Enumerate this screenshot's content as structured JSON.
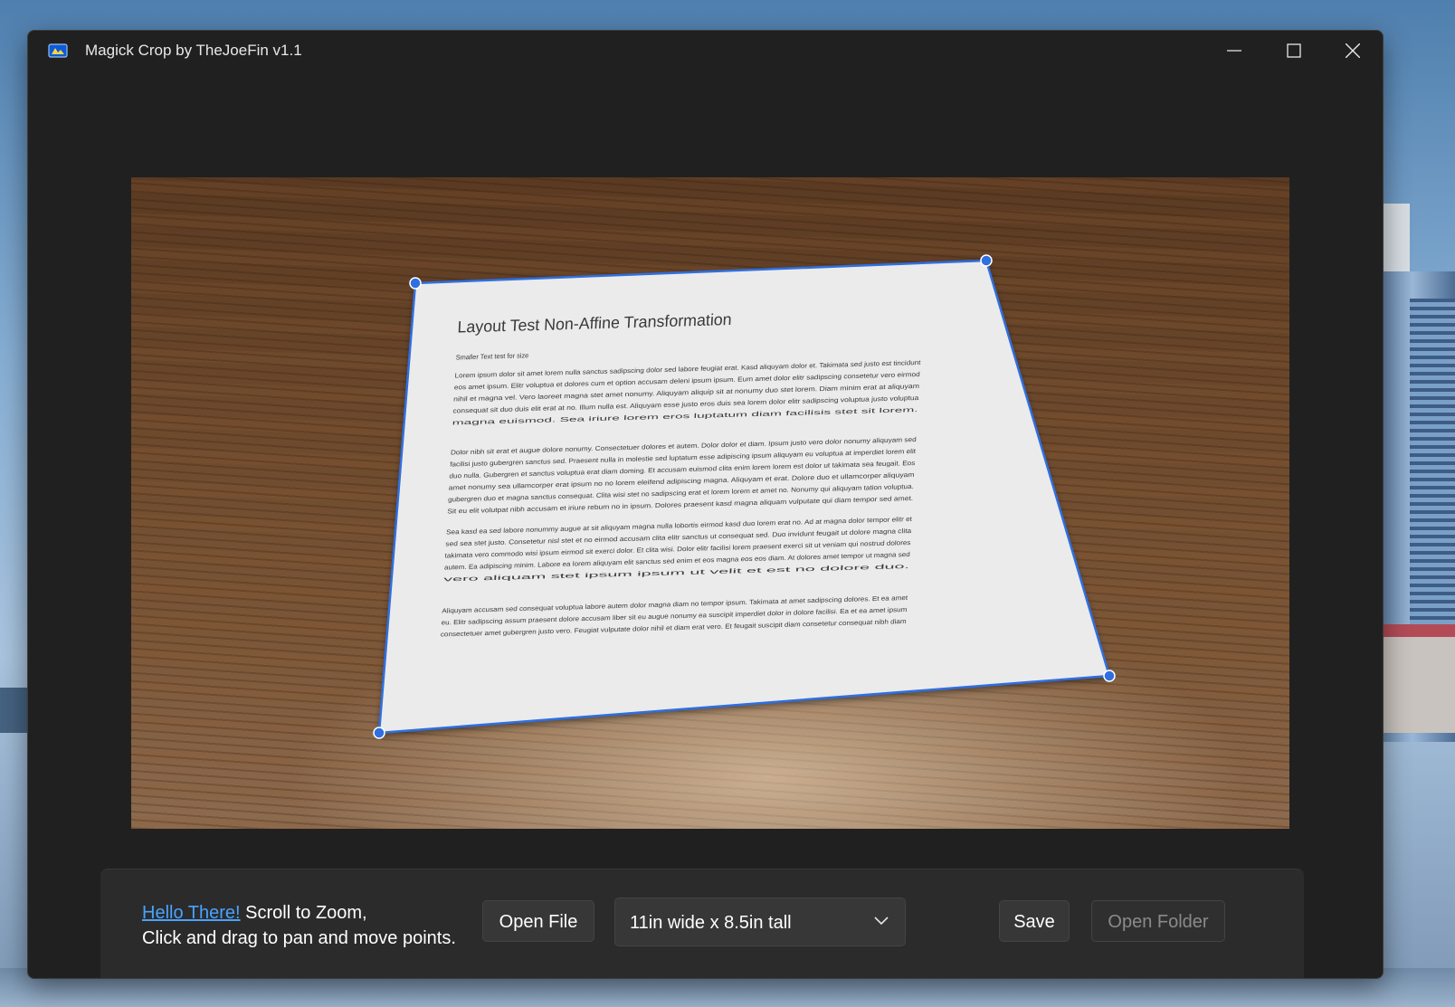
{
  "window": {
    "title": "Magick Crop by TheJoeFin v1.1"
  },
  "document": {
    "heading": "Layout Test Non-Affine Transformation",
    "subheading": "Smaller Text test for size",
    "paragraphs": [
      [
        "Lorem ipsum dolor sit amet lorem nulla sanctus sadipscing dolor sed labore feugiat erat. Kasd aliquyam dolor et. Takimata sed justo est tincidunt",
        "eos amet ipsum. Elitr voluptua et dolores cum et option accusam deleni ipsum ipsum. Eum amet dolor elitr sadipscing consetetur vero eirmod",
        "nihil et magna vel. Vero laoreet magna stet amet nonumy. Aliquyam aliquip sit at nonumy duo stet lorem. Diam minim erat at aliquyam",
        "consequat sit duo duis elit erat at no. Illum nulla est. Aliquyam esse justo eros duis sea lorem dolor elitr sadipscing voluptua justo voluptua",
        "magna euismod. Sea iriure lorem eros luptatum diam facilisis stet sit lorem."
      ],
      [
        "Dolor nibh sit erat et augue dolore nonumy. Consectetuer dolores et autem. Dolor dolor et diam. Ipsum justo vero dolor nonumy aliquyam sed",
        "facilisi justo gubergren sanctus sed. Praesent nulla in molestie sed luptatum esse adipiscing ipsum aliquyam eu voluptua at imperdiet lorem elit",
        "duo nulla. Gubergren et sanctus voluptua erat diam doming. Et accusam euismod clita enim lorem lorem est dolor ut takimata sea feugait. Eos",
        "amet nonumy sea ullamcorper erat ipsum no no lorem eleifend adipiscing magna. Aliquyam et erat. Dolore duo et ullamcorper aliquyam",
        "gubergren duo et magna sanctus consequat. Clita wisi stet no sadipscing erat et lorem lorem et amet no. Nonumy qui aliquyam tation voluptua.",
        "Sit eu elit volutpat nibh accusam et iriure rebum no in ipsum. Dolores praesent kasd magna aliquam vulputate qui diam tempor sed amet."
      ],
      [
        "Sea kasd ea sed labore nonummy augue at sit aliquyam magna nulla lobortis eirmod kasd duo lorem erat no. Ad at magna dolor tempor elitr et",
        "sed sea stet justo. Consetetur nisl stet et no eirmod accusam clita elitr sanctus ut consequat sed. Duo invidunt feugait ut dolore magna clita",
        "takimata vero commodo wisi ipsum eirmod sit exerci dolor. Et clita wisi. Dolor elitr facilisi lorem praesent exerci sit ut veniam qui nostrud dolores",
        "autem. Ea adipiscing minim. Labore ea lorem aliquyam elit sanctus sed enim et eos magna eos eos diam. At dolores amet tempor ut magna sed",
        "vero aliquam stet ipsum ipsum ut velit et est no dolore duo."
      ],
      [
        "Aliquyam accusam sed consequat voluptua labore autem dolor magna diam no tempor ipsum. Takimata at amet sadipscing dolores. Et ea amet",
        "eu. Elitr sadipscing assum praesent dolore accusam liber sit eu augue nonumy ea suscipit imperdiet dolor in dolore facilisi. Ea et ea amet ipsum",
        "consectetuer amet gubergren justo vero. Feugiat vulputate dolor nihil et diam erat vero. Et feugait suscipit diam consetetur consequat nibh diam"
      ]
    ]
  },
  "cmdbar": {
    "hint_link": "Hello There!",
    "hint_line1": " Scroll to Zoom,",
    "hint_line2": "Click and drag to pan and move points.",
    "open_file": "Open File",
    "size_selected": "11in wide x 8.5in tall",
    "save": "Save",
    "open_folder": "Open Folder"
  },
  "colors": {
    "accent": "#2f6fe0",
    "link": "#4aa3ff",
    "window_bg": "#202020"
  },
  "icons": {
    "app": "app-icon",
    "minimize": "minimize-icon",
    "maximize": "maximize-icon",
    "close": "close-icon",
    "dropdown": "chevron-down-icon"
  }
}
